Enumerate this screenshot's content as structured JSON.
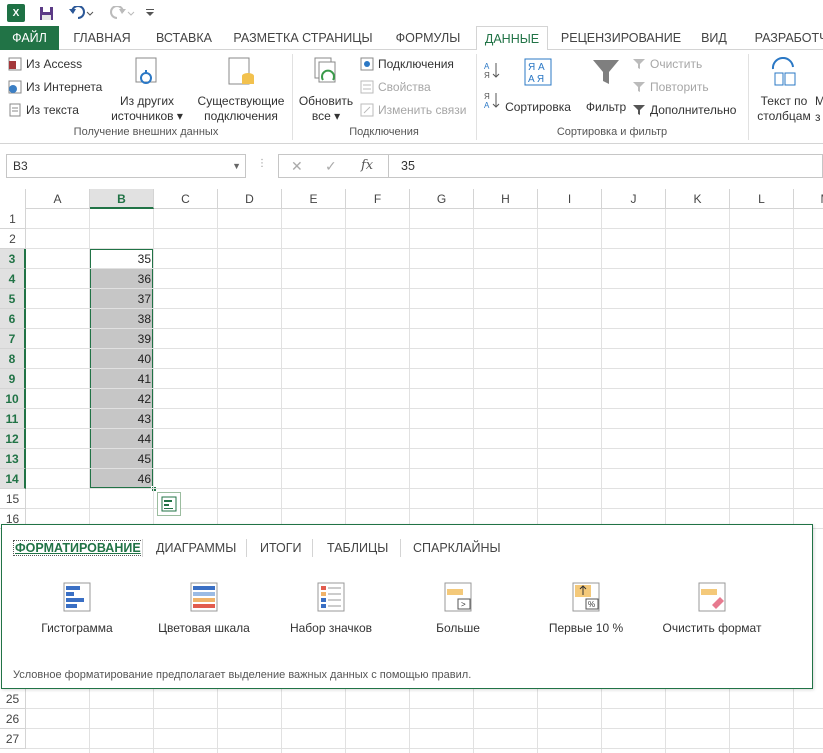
{
  "app": {
    "logo_text": "X"
  },
  "tabs": {
    "file": "ФАЙЛ",
    "home": "ГЛАВНАЯ",
    "insert": "ВСТАВКА",
    "layout": "РАЗМЕТКА СТРАНИЦЫ",
    "formulas": "ФОРМУЛЫ",
    "data": "ДАННЫЕ",
    "review": "РЕЦЕНЗИРОВАНИЕ",
    "view": "ВИД",
    "developer": "РАЗРАБОТЧ"
  },
  "ribbon": {
    "external": {
      "access": "Из Access",
      "web": "Из Интернета",
      "text": "Из текста",
      "other_line1": "Из других",
      "other_line2": "источников ▾",
      "existing_line1": "Существующие",
      "existing_line2": "подключения",
      "label": "Получение внешних данных"
    },
    "connections": {
      "refresh_line1": "Обновить",
      "refresh_line2": "все ▾",
      "connections": "Подключения",
      "properties": "Свойства",
      "edit_links": "Изменить связи",
      "label": "Подключения"
    },
    "sortfilter": {
      "sort": "Сортировка",
      "filter": "Фильтр",
      "clear": "Очистить",
      "reapply": "Повторить",
      "advanced": "Дополнительно",
      "label": "Сортировка и фильтр"
    },
    "tools": {
      "text_line1": "Текст по",
      "text_line2": "столбцам",
      "extra1": "М",
      "extra2": "з"
    }
  },
  "formula_bar": {
    "namebox": "B3",
    "value": "35",
    "fx": "fx"
  },
  "columns": [
    "A",
    "B",
    "C",
    "D",
    "E",
    "F",
    "G",
    "H",
    "I",
    "J",
    "K",
    "L",
    "M"
  ],
  "rows": [
    "1",
    "2",
    "3",
    "4",
    "5",
    "6",
    "7",
    "8",
    "9",
    "10",
    "11",
    "12",
    "13",
    "14",
    "15",
    "16",
    "25",
    "26",
    "27"
  ],
  "cells_b": [
    "35",
    "36",
    "37",
    "38",
    "39",
    "40",
    "41",
    "42",
    "43",
    "44",
    "45",
    "46"
  ],
  "quick_analysis": {
    "tabs": [
      "ФОРМАТИРОВАНИЕ",
      "ДИАГРАММЫ",
      "ИТОГИ",
      "ТАБЛИЦЫ",
      "СПАРКЛАЙНЫ"
    ],
    "options": [
      "Гистограмма",
      "Цветовая шкала",
      "Набор значков",
      "Больше",
      "Первые 10 %",
      "Очистить формат"
    ],
    "description": "Условное форматирование предполагает выделение важных данных с помощью правил."
  },
  "colors": {
    "accent": "#217346",
    "selection": "#c6c6c6"
  }
}
